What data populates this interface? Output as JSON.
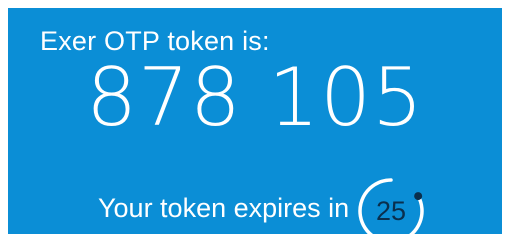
{
  "otp_card": {
    "title": "Exer OTP token is:",
    "token": "878 105",
    "expiry_label": "Your token expires in",
    "countdown_seconds": "25",
    "countdown_fraction_remaining": 0.83,
    "colors": {
      "background": "#0b8ed6",
      "text": "#ffffff",
      "countdown_text": "#0a2f4d",
      "ring": "#ffffff",
      "ring_dot": "#0a2f4d"
    }
  }
}
